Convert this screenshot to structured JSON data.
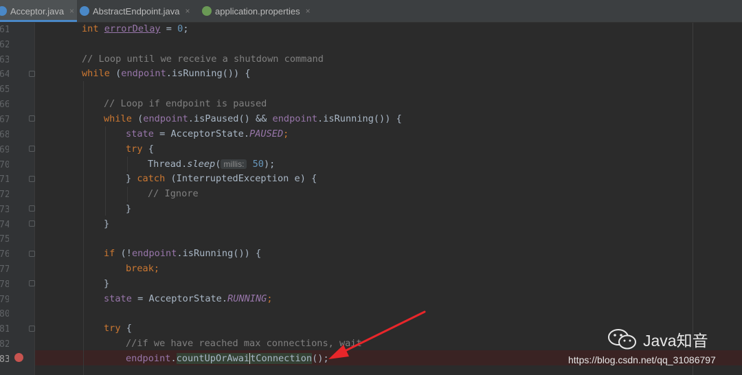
{
  "tabs": [
    {
      "label": "Acceptor.java",
      "close": "×",
      "active": true,
      "icon_color": "#4a88c7"
    },
    {
      "label": "AbstractEndpoint.java",
      "close": "×",
      "active": false,
      "icon_color": "#4a88c7"
    },
    {
      "label": "application.properties",
      "close": "×",
      "active": false,
      "icon_color": "#6a9955"
    }
  ],
  "gutter": {
    "line_numbers": [
      "61",
      "62",
      "63",
      "64",
      "65",
      "66",
      "67",
      "68",
      "69",
      "70",
      "71",
      "72",
      "73",
      "74",
      "75",
      "76",
      "77",
      "78",
      "79",
      "80",
      "81",
      "82",
      "83"
    ]
  },
  "code": {
    "l1": {
      "kw": "int",
      "var": "errorDelay",
      "rest": " = ",
      "num": "0",
      "end": ";"
    },
    "l3": {
      "comment": "// Loop until we receive a shutdown command"
    },
    "l4": {
      "kw": "while",
      "a": " (",
      "fld": "endpoint",
      "b": ".isRunning()) {"
    },
    "l6": {
      "comment": "// Loop if endpoint is paused"
    },
    "l7": {
      "kw": "while",
      "a": " (",
      "fld1": "endpoint",
      "b": ".isPaused() && ",
      "fld2": "endpoint",
      "c": ".isRunning()) {"
    },
    "l8": {
      "fld": "state",
      "a": " = AcceptorState.",
      "const": "PAUSED",
      "end": ";"
    },
    "l9": {
      "kw": "try",
      "a": " {"
    },
    "l10": {
      "a": "Thread.",
      "method": "sleep",
      "b": "(",
      "hint": "millis:",
      "num": "50",
      "end": ");"
    },
    "l11": {
      "a": "} ",
      "kw": "catch",
      "b": " (InterruptedException e) {"
    },
    "l12": {
      "comment": "// Ignore"
    },
    "l13": {
      "a": "}"
    },
    "l14": {
      "a": "}"
    },
    "l16": {
      "kw": "if",
      "a": " (!",
      "fld": "endpoint",
      "b": ".isRunning()) {"
    },
    "l17": {
      "kw": "break",
      "end": ";"
    },
    "l18": {
      "a": "}"
    },
    "l19": {
      "fld": "state",
      "a": " = AcceptorState.",
      "const": "RUNNING",
      "end": ";"
    },
    "l21": {
      "kw": "try",
      "a": " {"
    },
    "l22": {
      "comment": "//if we have reached max connections, wait"
    },
    "l23": {
      "fld": "endpoint",
      "a": ".",
      "method_pre": "countUpOrAwai",
      "method_post": "tConnection",
      "end": "();"
    }
  },
  "watermark": {
    "brand": "Java知音",
    "url": "https://blog.csdn.net/qq_31086797"
  },
  "colors": {
    "keyword": "#cc7832",
    "comment": "#808080",
    "number": "#6897bb",
    "field": "#9876aa",
    "arrow": "#e8262a",
    "breakpoint": "#c75450"
  }
}
